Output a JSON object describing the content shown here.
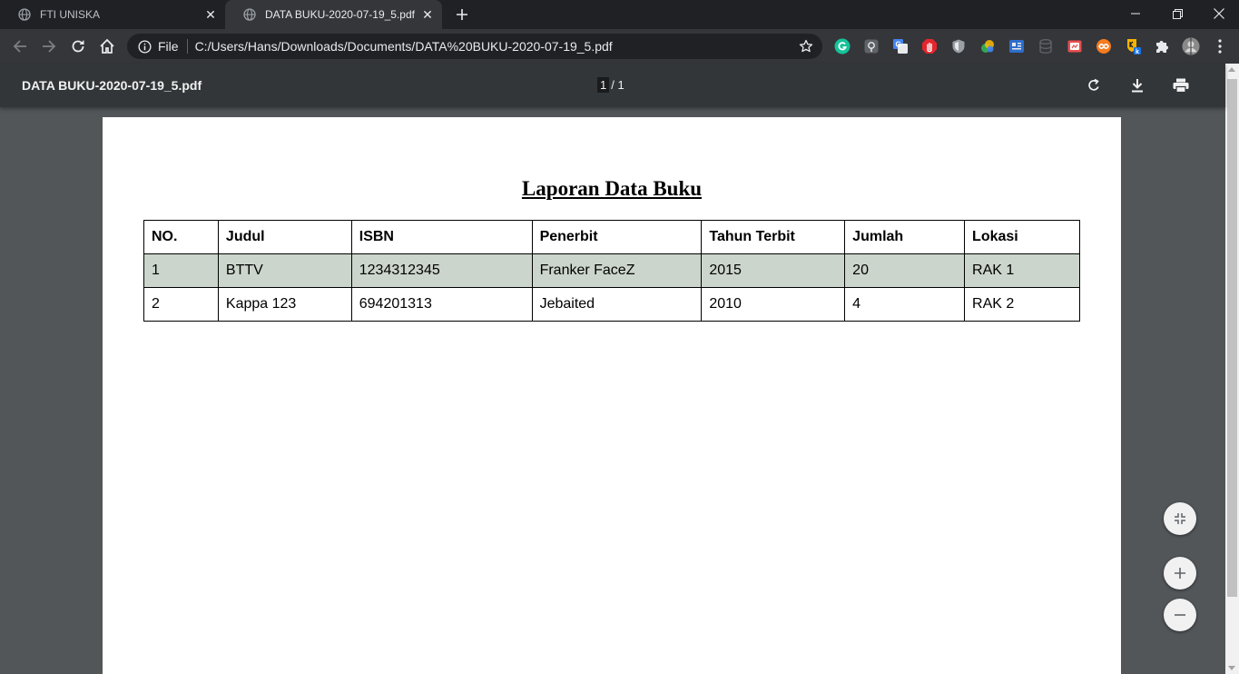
{
  "browser": {
    "tabs": [
      {
        "title": "FTI UNISKA",
        "active": false
      },
      {
        "title": "DATA BUKU-2020-07-19_5.pdf",
        "active": true
      }
    ],
    "omnibox": {
      "scheme_label": "File",
      "url": "C:/Users/Hans/Downloads/Documents/DATA%20BUKU-2020-07-19_5.pdf"
    },
    "extensions": [
      "grammarly-icon",
      "extension-icon",
      "translate-icon",
      "adblock-icon",
      "shield-icon",
      "color-picker-icon",
      "extension-icon",
      "database-icon",
      "extension-icon",
      "extension-icon",
      "keeper-icon",
      "puzzle-icon"
    ]
  },
  "pdf_viewer": {
    "filename": "DATA BUKU-2020-07-19_5.pdf",
    "page_current": "1",
    "page_total": "/ 1"
  },
  "document": {
    "title": "Laporan Data Buku",
    "table": {
      "headers": [
        "NO.",
        "Judul",
        "ISBN",
        "Penerbit",
        "Tahun Terbit",
        "Jumlah",
        "Lokasi"
      ],
      "rows": [
        [
          "1",
          "BTTV",
          "1234312345",
          "Franker FaceZ",
          "2015",
          "20",
          "RAK 1"
        ],
        [
          "2",
          "Kappa 123",
          "694201313",
          "Jebaited",
          "2010",
          "4",
          "RAK 2"
        ]
      ]
    }
  },
  "colors": {
    "tabstrip_bg": "#202124",
    "toolbar_bg": "#35363a",
    "pdf_toolbar_bg": "#323639",
    "viewer_bg": "#525659",
    "row_shade": "#ccd5cc"
  }
}
